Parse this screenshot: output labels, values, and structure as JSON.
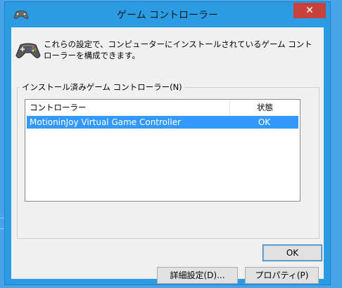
{
  "window": {
    "title": "ゲーム コントローラー",
    "close_glyph": "✕"
  },
  "description": "これらの設定で、コンピューターにインストールされているゲーム コントローラーを構成できます。",
  "group": {
    "label": "インストール済みゲーム コントローラー(N)"
  },
  "list": {
    "columns": [
      "コントローラー",
      "状態"
    ],
    "rows": [
      {
        "name": "MotioninJoy Virtual Game Controller",
        "state": "OK",
        "selected": true
      }
    ]
  },
  "buttons": {
    "advanced": "詳細設定(D)...",
    "properties": "プロパティ(P)",
    "ok": "OK"
  },
  "icons": {
    "app": "gamepad-icon",
    "header": "gamepad-icon"
  },
  "colors": {
    "titlebar": "#2b9be4",
    "close_button": "#c7423a",
    "selection": "#3399ff",
    "desktop": "#4aa3e6"
  }
}
